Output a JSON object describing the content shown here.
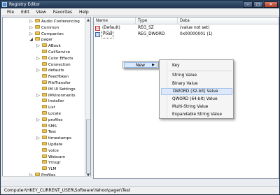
{
  "window": {
    "title": "Registry Editor",
    "minimize": "–",
    "maximize": "□",
    "close": "✕"
  },
  "menubar": [
    "File",
    "Edit",
    "View",
    "Favorites",
    "Help"
  ],
  "tree": {
    "items": [
      {
        "label": "Audio Conferencing",
        "depth": 0,
        "expander": "▷"
      },
      {
        "label": "Common",
        "depth": 0,
        "expander": "▷"
      },
      {
        "label": "Companion",
        "depth": 0,
        "expander": "▷"
      },
      {
        "label": "pager",
        "depth": 0,
        "expander": "◢"
      },
      {
        "label": "ABook",
        "depth": 1,
        "expander": "▷"
      },
      {
        "label": "CallService",
        "depth": 1,
        "expander": ""
      },
      {
        "label": "Color Effects",
        "depth": 1,
        "expander": "▷"
      },
      {
        "label": "Connection",
        "depth": 1,
        "expander": ""
      },
      {
        "label": "defaults",
        "depth": 1,
        "expander": "▷"
      },
      {
        "label": "FeedToken",
        "depth": 1,
        "expander": ""
      },
      {
        "label": "FileTransfer",
        "depth": 1,
        "expander": ""
      },
      {
        "label": "IM UI Settings",
        "depth": 1,
        "expander": ""
      },
      {
        "label": "IMVironments",
        "depth": 1,
        "expander": "▷"
      },
      {
        "label": "Installer",
        "depth": 1,
        "expander": ""
      },
      {
        "label": "List",
        "depth": 1,
        "expander": ""
      },
      {
        "label": "Locale",
        "depth": 1,
        "expander": ""
      },
      {
        "label": "profiles",
        "depth": 1,
        "expander": "▷"
      },
      {
        "label": "SMS",
        "depth": 1,
        "expander": ""
      },
      {
        "label": "Test",
        "depth": 1,
        "expander": ""
      },
      {
        "label": "timestamps",
        "depth": 1,
        "expander": "▷"
      },
      {
        "label": "Update",
        "depth": 1,
        "expander": ""
      },
      {
        "label": "voice",
        "depth": 1,
        "expander": ""
      },
      {
        "label": "Webcam",
        "depth": 1,
        "expander": ""
      },
      {
        "label": "Ymsgr",
        "depth": 1,
        "expander": ""
      },
      {
        "label": "YLM",
        "depth": 1,
        "expander": ""
      },
      {
        "label": "Profiles",
        "depth": 0,
        "expander": "▷"
      }
    ]
  },
  "list": {
    "columns": [
      "Name",
      "Type",
      "Data"
    ],
    "rows": [
      {
        "icon": "ab",
        "name": "(Default)",
        "type": "REG_SZ",
        "data": "(value not set)"
      },
      {
        "icon": "dw",
        "name": "Pixel",
        "type": "REG_DWORD",
        "data": "0x00000001 (1)"
      }
    ]
  },
  "context_menu": {
    "new_label": "New",
    "submenu": [
      {
        "label": "Key",
        "highlighted": false
      },
      {
        "label": "String Value",
        "highlighted": false
      },
      {
        "label": "Binary Value",
        "highlighted": false
      },
      {
        "label": "DWORD (32-bit) Value",
        "highlighted": true
      },
      {
        "label": "QWORD (64-bit) Value",
        "highlighted": false
      },
      {
        "label": "Multi-String Value",
        "highlighted": false
      },
      {
        "label": "Expandable String Value",
        "highlighted": false
      }
    ]
  },
  "statusbar": {
    "path": "Computer\\HKEY_CURRENT_USER\\Software\\Yahoo\\pager\\Test"
  }
}
